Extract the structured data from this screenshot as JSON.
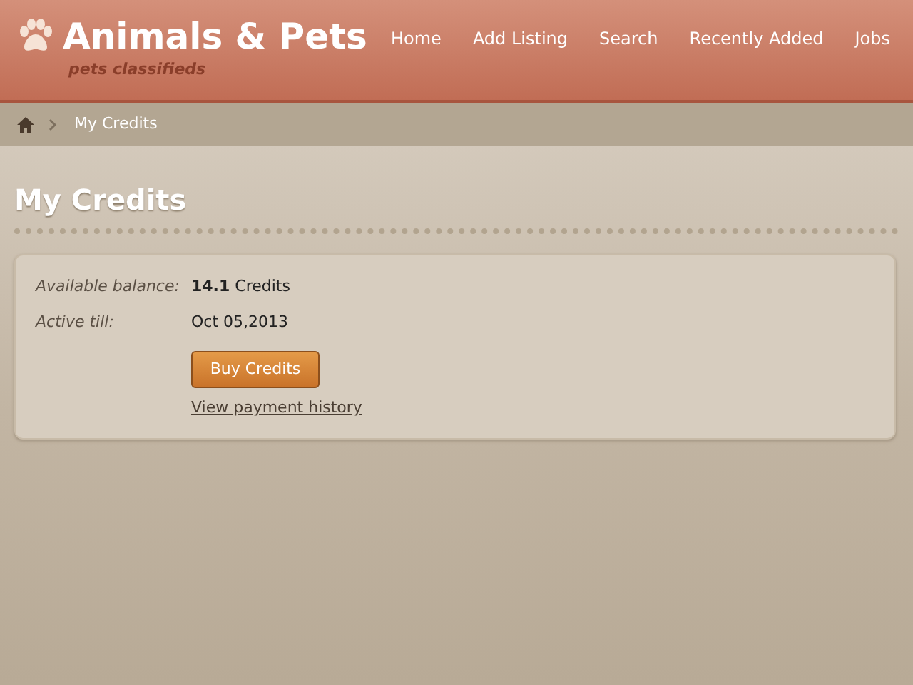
{
  "header": {
    "logo_title": "Animals & Pets",
    "logo_subtitle": "pets classifieds",
    "nav": [
      {
        "label": "Home"
      },
      {
        "label": "Add Listing"
      },
      {
        "label": "Search"
      },
      {
        "label": "Recently Added"
      },
      {
        "label": "Jobs"
      }
    ]
  },
  "breadcrumb": {
    "current": "My Credits"
  },
  "page_title": "My Credits",
  "details": [
    {
      "label": "Available balance:",
      "value": "**14.1** Credits"
    },
    {
      "label": "Active till:",
      "value": "Oct 05,2013"
    }
  ],
  "buy_button": "Buy Credits",
  "history_link": "View payment history"
}
